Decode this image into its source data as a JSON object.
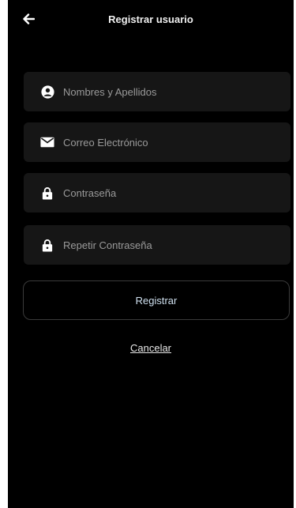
{
  "header": {
    "title": "Registrar usuario",
    "back_icon": "arrow-left-icon"
  },
  "form": {
    "fields": [
      {
        "icon": "user-circle-icon",
        "placeholder": "Nombres y Apellidos"
      },
      {
        "icon": "envelope-icon",
        "placeholder": "Correo Electrónico"
      },
      {
        "icon": "lock-icon",
        "placeholder": "Contraseña"
      },
      {
        "icon": "lock-icon",
        "placeholder": "Repetir Contraseña"
      }
    ],
    "submit_label": "Registrar",
    "cancel_label": "Cancelar"
  },
  "colors": {
    "background": "#000000",
    "field_background": "#161616",
    "placeholder_text": "#9a9a9a",
    "register_text": "#cfe0ef"
  }
}
